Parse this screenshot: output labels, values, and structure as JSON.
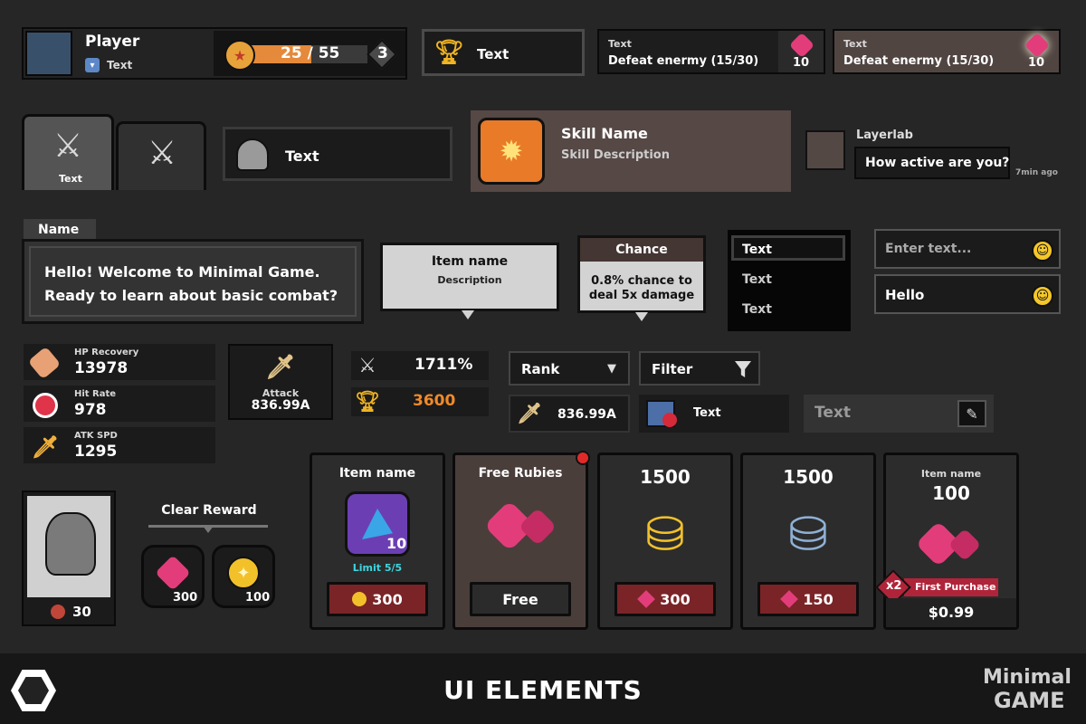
{
  "player": {
    "name": "Player",
    "sub": "Text",
    "xp": "25 / 55",
    "level": "3"
  },
  "trophy": {
    "label": "Text"
  },
  "quest1": {
    "title": "Text",
    "desc": "Defeat enermy (15/30)",
    "reward": "10"
  },
  "quest2": {
    "title": "Text",
    "desc": "Defeat enermy (15/30)",
    "reward": "10"
  },
  "tabs": {
    "t1": "Text"
  },
  "knight_row": {
    "label": "Text"
  },
  "skill": {
    "name": "Skill Name",
    "desc": "Skill Description"
  },
  "chat": {
    "name": "Layerlab",
    "msg": "How active are you?",
    "time": "7min ago"
  },
  "dialog": {
    "name": "Name",
    "line1": "Hello! Welcome to Minimal Game.",
    "line2": "Ready to learn about basic combat?"
  },
  "tooltip": {
    "title": "Item name",
    "desc": "Description"
  },
  "chance": {
    "title": "Chance",
    "line1": "0.8% chance to",
    "line2": "deal 5x damage"
  },
  "menu": {
    "items": [
      "Text",
      "Text",
      "Text"
    ]
  },
  "inputs": {
    "placeholder": "Enter text...",
    "value": "Hello"
  },
  "stats": [
    {
      "label": "HP Recovery",
      "value": "13978"
    },
    {
      "label": "Hit Rate",
      "value": "978"
    },
    {
      "label": "ATK SPD",
      "value": "1295"
    }
  ],
  "attack": {
    "label": "Attack",
    "value": "836.99A"
  },
  "pct": {
    "value": "1711%"
  },
  "gold": {
    "value": "3600"
  },
  "rank": {
    "label": "Rank"
  },
  "filter": {
    "label": "Filter"
  },
  "atk2": {
    "value": "836.99A"
  },
  "video": {
    "label": "Text"
  },
  "edit": {
    "label": "Text"
  },
  "portrait": {
    "cost": "30"
  },
  "clear": {
    "title": "Clear Reward",
    "r1": "300",
    "r2": "100"
  },
  "shop": [
    {
      "title": "Item name",
      "count": "10",
      "limit": "Limit 5/5",
      "price": "300"
    },
    {
      "title": "Free Rubies",
      "price": "Free"
    },
    {
      "title": "1500",
      "price": "300"
    },
    {
      "title": "1500",
      "price": "150"
    },
    {
      "title_small": "Item name",
      "title": "100",
      "mult": "x2",
      "ribbon": "First Purchase",
      "price": "$0.99"
    }
  ],
  "footer": {
    "title": "UI ELEMENTS",
    "brand1": "Minimal",
    "brand2": "GAME"
  }
}
